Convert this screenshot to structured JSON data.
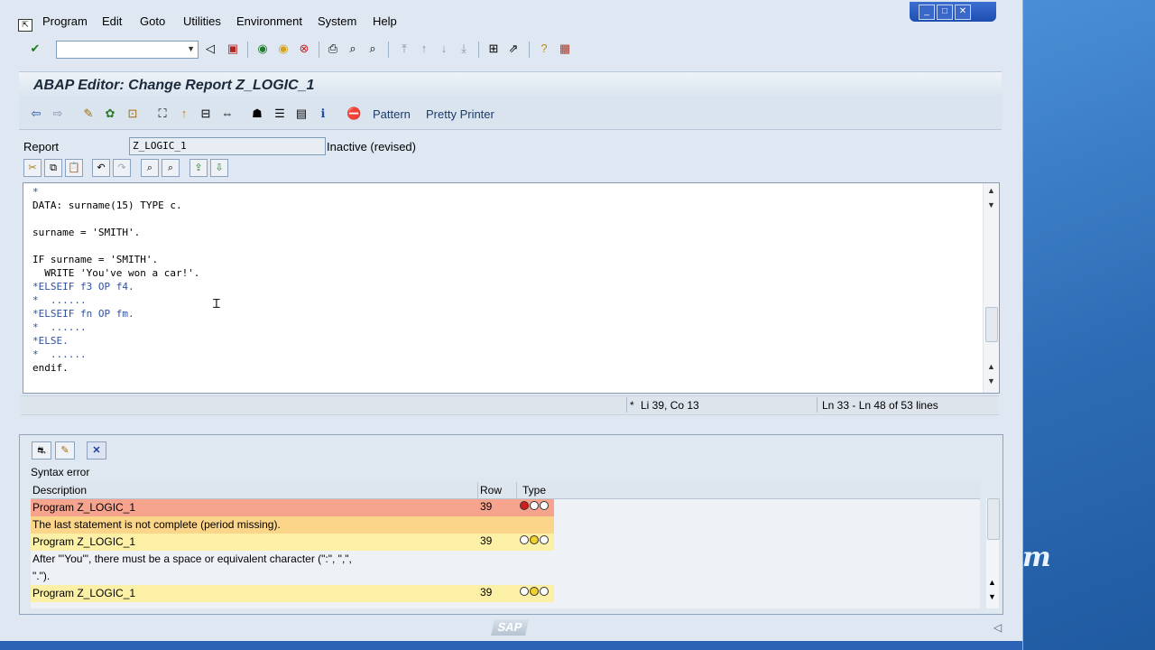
{
  "menu": [
    "Program",
    "Edit",
    "Goto",
    "Utilities",
    "Environment",
    "System",
    "Help"
  ],
  "title": "ABAP Editor: Change Report Z_LOGIC_1",
  "toolbar2": {
    "pattern": "Pattern",
    "pretty_printer": "Pretty Printer"
  },
  "report": {
    "label": "Report",
    "value": "Z_LOGIC_1",
    "status": "Inactive (revised)"
  },
  "code": [
    {
      "text": "*",
      "comment": true
    },
    {
      "text": "DATA: surname(15) TYPE c.",
      "comment": false
    },
    {
      "text": "",
      "comment": false
    },
    {
      "text": "surname = 'SMITH'.",
      "comment": false
    },
    {
      "text": "",
      "comment": false
    },
    {
      "text": "IF surname = 'SMITH'.",
      "comment": false
    },
    {
      "text": "  WRITE 'You've won a car!'.",
      "comment": false
    },
    {
      "text": "*ELSEIF f3 OP f4.",
      "comment": true
    },
    {
      "text": "*  ......",
      "comment": true
    },
    {
      "text": "*ELSEIF fn OP fm.",
      "comment": true
    },
    {
      "text": "*  ......",
      "comment": true
    },
    {
      "text": "*ELSE.",
      "comment": true
    },
    {
      "text": "*  ......",
      "comment": true
    },
    {
      "text": "endif.",
      "comment": false
    }
  ],
  "status": {
    "marker": "*",
    "cursor": "Li 39, Co 13",
    "range": "Ln 33 - Ln 48 of 53 lines"
  },
  "errors": {
    "heading": "Syntax error",
    "columns": {
      "description": "Description",
      "row": "Row",
      "type": "Type"
    },
    "rows": [
      {
        "description": "Program Z_LOGIC_1",
        "row": "39",
        "lights": [
          "red",
          "white",
          "white"
        ],
        "color": "#f7a48f"
      },
      {
        "description": "The last statement is not complete (period missing).",
        "row": "",
        "lights": [],
        "color": "#fbd58a"
      },
      {
        "description": "Program Z_LOGIC_1",
        "row": "39",
        "lights": [
          "white",
          "yellow",
          "white"
        ],
        "color": "#fbf0a6"
      },
      {
        "description": "After \"'You'\", there must be a space or equivalent character (\":\", \",\",",
        "row": "",
        "lights": [],
        "color": "#eef2f7"
      },
      {
        "description": "\".\").",
        "row": "",
        "lights": [],
        "color": "#eef2f7"
      },
      {
        "description": "Program Z_LOGIC_1",
        "row": "39",
        "lights": [
          "white",
          "yellow",
          "white"
        ],
        "color": "#fbf0a6"
      }
    ]
  },
  "footer_logo": "SAP",
  "desktop_text": "m"
}
